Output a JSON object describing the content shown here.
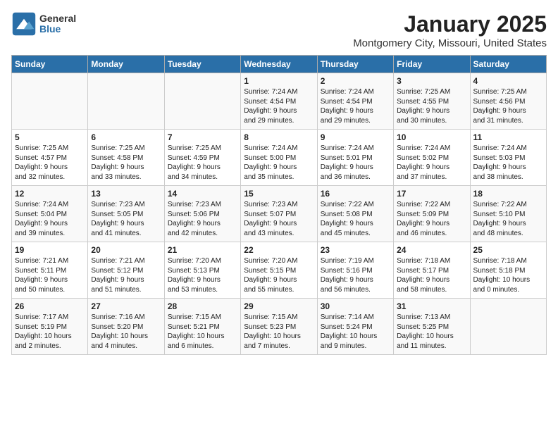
{
  "header": {
    "logo_general": "General",
    "logo_blue": "Blue",
    "title": "January 2025",
    "subtitle": "Montgomery City, Missouri, United States"
  },
  "days_of_week": [
    "Sunday",
    "Monday",
    "Tuesday",
    "Wednesday",
    "Thursday",
    "Friday",
    "Saturday"
  ],
  "weeks": [
    [
      {
        "day": "",
        "info": ""
      },
      {
        "day": "",
        "info": ""
      },
      {
        "day": "",
        "info": ""
      },
      {
        "day": "1",
        "info": "Sunrise: 7:24 AM\nSunset: 4:54 PM\nDaylight: 9 hours\nand 29 minutes."
      },
      {
        "day": "2",
        "info": "Sunrise: 7:24 AM\nSunset: 4:54 PM\nDaylight: 9 hours\nand 29 minutes."
      },
      {
        "day": "3",
        "info": "Sunrise: 7:25 AM\nSunset: 4:55 PM\nDaylight: 9 hours\nand 30 minutes."
      },
      {
        "day": "4",
        "info": "Sunrise: 7:25 AM\nSunset: 4:56 PM\nDaylight: 9 hours\nand 31 minutes."
      }
    ],
    [
      {
        "day": "5",
        "info": "Sunrise: 7:25 AM\nSunset: 4:57 PM\nDaylight: 9 hours\nand 32 minutes."
      },
      {
        "day": "6",
        "info": "Sunrise: 7:25 AM\nSunset: 4:58 PM\nDaylight: 9 hours\nand 33 minutes."
      },
      {
        "day": "7",
        "info": "Sunrise: 7:25 AM\nSunset: 4:59 PM\nDaylight: 9 hours\nand 34 minutes."
      },
      {
        "day": "8",
        "info": "Sunrise: 7:24 AM\nSunset: 5:00 PM\nDaylight: 9 hours\nand 35 minutes."
      },
      {
        "day": "9",
        "info": "Sunrise: 7:24 AM\nSunset: 5:01 PM\nDaylight: 9 hours\nand 36 minutes."
      },
      {
        "day": "10",
        "info": "Sunrise: 7:24 AM\nSunset: 5:02 PM\nDaylight: 9 hours\nand 37 minutes."
      },
      {
        "day": "11",
        "info": "Sunrise: 7:24 AM\nSunset: 5:03 PM\nDaylight: 9 hours\nand 38 minutes."
      }
    ],
    [
      {
        "day": "12",
        "info": "Sunrise: 7:24 AM\nSunset: 5:04 PM\nDaylight: 9 hours\nand 39 minutes."
      },
      {
        "day": "13",
        "info": "Sunrise: 7:23 AM\nSunset: 5:05 PM\nDaylight: 9 hours\nand 41 minutes."
      },
      {
        "day": "14",
        "info": "Sunrise: 7:23 AM\nSunset: 5:06 PM\nDaylight: 9 hours\nand 42 minutes."
      },
      {
        "day": "15",
        "info": "Sunrise: 7:23 AM\nSunset: 5:07 PM\nDaylight: 9 hours\nand 43 minutes."
      },
      {
        "day": "16",
        "info": "Sunrise: 7:22 AM\nSunset: 5:08 PM\nDaylight: 9 hours\nand 45 minutes."
      },
      {
        "day": "17",
        "info": "Sunrise: 7:22 AM\nSunset: 5:09 PM\nDaylight: 9 hours\nand 46 minutes."
      },
      {
        "day": "18",
        "info": "Sunrise: 7:22 AM\nSunset: 5:10 PM\nDaylight: 9 hours\nand 48 minutes."
      }
    ],
    [
      {
        "day": "19",
        "info": "Sunrise: 7:21 AM\nSunset: 5:11 PM\nDaylight: 9 hours\nand 50 minutes."
      },
      {
        "day": "20",
        "info": "Sunrise: 7:21 AM\nSunset: 5:12 PM\nDaylight: 9 hours\nand 51 minutes."
      },
      {
        "day": "21",
        "info": "Sunrise: 7:20 AM\nSunset: 5:13 PM\nDaylight: 9 hours\nand 53 minutes."
      },
      {
        "day": "22",
        "info": "Sunrise: 7:20 AM\nSunset: 5:15 PM\nDaylight: 9 hours\nand 55 minutes."
      },
      {
        "day": "23",
        "info": "Sunrise: 7:19 AM\nSunset: 5:16 PM\nDaylight: 9 hours\nand 56 minutes."
      },
      {
        "day": "24",
        "info": "Sunrise: 7:18 AM\nSunset: 5:17 PM\nDaylight: 9 hours\nand 58 minutes."
      },
      {
        "day": "25",
        "info": "Sunrise: 7:18 AM\nSunset: 5:18 PM\nDaylight: 10 hours\nand 0 minutes."
      }
    ],
    [
      {
        "day": "26",
        "info": "Sunrise: 7:17 AM\nSunset: 5:19 PM\nDaylight: 10 hours\nand 2 minutes."
      },
      {
        "day": "27",
        "info": "Sunrise: 7:16 AM\nSunset: 5:20 PM\nDaylight: 10 hours\nand 4 minutes."
      },
      {
        "day": "28",
        "info": "Sunrise: 7:15 AM\nSunset: 5:21 PM\nDaylight: 10 hours\nand 6 minutes."
      },
      {
        "day": "29",
        "info": "Sunrise: 7:15 AM\nSunset: 5:23 PM\nDaylight: 10 hours\nand 7 minutes."
      },
      {
        "day": "30",
        "info": "Sunrise: 7:14 AM\nSunset: 5:24 PM\nDaylight: 10 hours\nand 9 minutes."
      },
      {
        "day": "31",
        "info": "Sunrise: 7:13 AM\nSunset: 5:25 PM\nDaylight: 10 hours\nand 11 minutes."
      },
      {
        "day": "",
        "info": ""
      }
    ]
  ]
}
